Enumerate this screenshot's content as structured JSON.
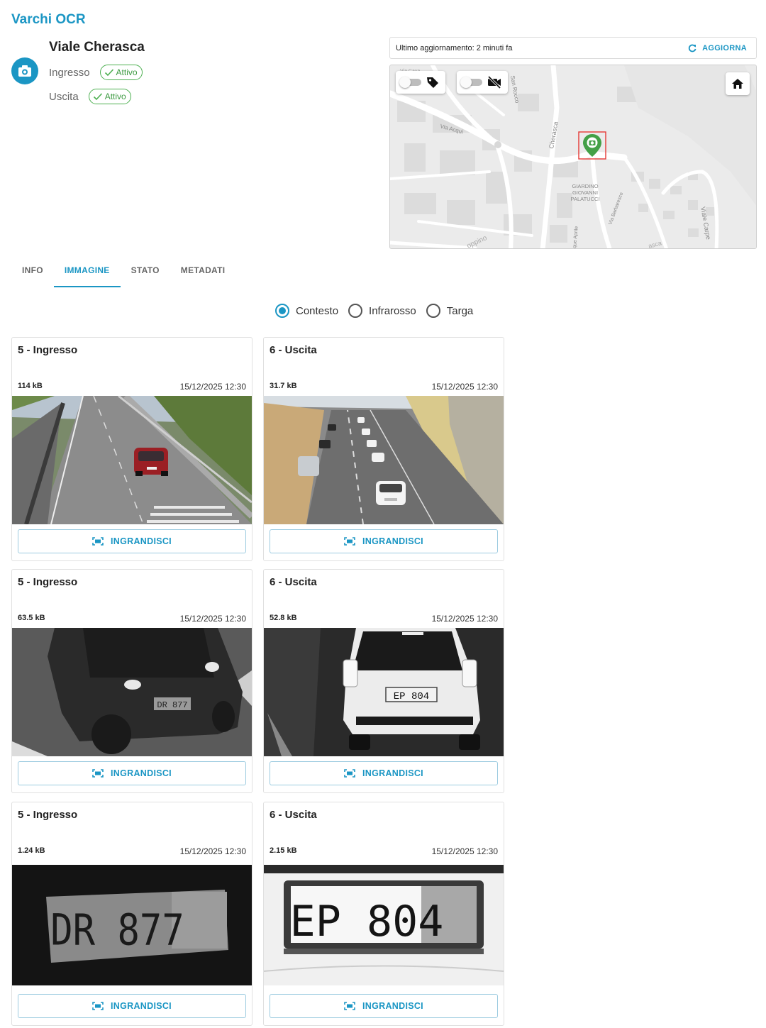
{
  "app": {
    "title": "Varchi OCR"
  },
  "gate": {
    "name": "Viale Cherasca",
    "directions": [
      {
        "label": "Ingresso",
        "status": "Attivo"
      },
      {
        "label": "Uscita",
        "status": "Attivo"
      }
    ]
  },
  "update": {
    "text": "Ultimo aggiornamento: 2 minuti fa",
    "refresh_label": "AGGIORNA"
  },
  "map": {
    "labels": {
      "street_cherasca": "Cherasca",
      "street_acqui": "Via Acqui",
      "street_sanrocco": "San Rocco",
      "park": [
        "GIARDINO",
        "GIOVANNI",
        "PALATUCCI"
      ],
      "street_barbaresco": "Via Barbaresco",
      "street_aprile": "que Aprile",
      "street_coppino": "oppino",
      "street_carpe": "Viale Carpe",
      "street_asca": "asca",
      "street_cava": "Via Cava"
    }
  },
  "tabs": [
    {
      "label": "INFO",
      "active": false
    },
    {
      "label": "IMMAGINE",
      "active": true
    },
    {
      "label": "STATO",
      "active": false
    },
    {
      "label": "METADATI",
      "active": false
    }
  ],
  "image_types": [
    {
      "label": "Contesto",
      "checked": true
    },
    {
      "label": "Infrarosso",
      "checked": false
    },
    {
      "label": "Targa",
      "checked": false
    }
  ],
  "enlarge_label": "INGRANDISCI",
  "cards": [
    {
      "title": "5 - Ingresso",
      "size": "114 kB",
      "time": "15/12/2025 12:30"
    },
    {
      "title": "6 - Uscita",
      "size": "31.7 kB",
      "time": "15/12/2025 12:30"
    },
    {
      "title": "5 - Ingresso",
      "size": "63.5 kB",
      "time": "15/12/2025 12:30"
    },
    {
      "title": "6 - Uscita",
      "size": "52.8 kB",
      "time": "15/12/2025 12:30"
    },
    {
      "title": "5 - Ingresso",
      "size": "1.24 kB",
      "time": "15/12/2025 12:30"
    },
    {
      "title": "6 - Uscita",
      "size": "2.15 kB",
      "time": "15/12/2025 12:30"
    }
  ],
  "plates": {
    "ir_ingresso": "DR 877",
    "ir_uscita": "EP 804",
    "plate_ingresso": "DR 877",
    "plate_uscita": "EP 804"
  },
  "colors": {
    "accent": "#1b96c4",
    "active": "#4caf50",
    "marker": "#43a047",
    "marker_box": "#e53935"
  }
}
